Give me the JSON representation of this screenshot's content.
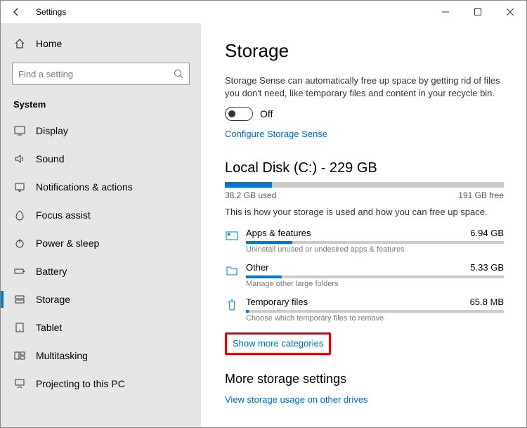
{
  "window": {
    "title": "Settings"
  },
  "sidebar": {
    "home": "Home",
    "search_placeholder": "Find a setting",
    "group": "System",
    "items": [
      {
        "label": "Display"
      },
      {
        "label": "Sound"
      },
      {
        "label": "Notifications & actions"
      },
      {
        "label": "Focus assist"
      },
      {
        "label": "Power & sleep"
      },
      {
        "label": "Battery"
      },
      {
        "label": "Storage"
      },
      {
        "label": "Tablet"
      },
      {
        "label": "Multitasking"
      },
      {
        "label": "Projecting to this PC"
      }
    ]
  },
  "page": {
    "title": "Storage",
    "sense_desc": "Storage Sense can automatically free up space by getting rid of files you don't need, like temporary files and content in your recycle bin.",
    "toggle_label": "Off",
    "configure_link": "Configure Storage Sense",
    "disk_title": "Local Disk (C:) - 229 GB",
    "used_label": "38.2 GB used",
    "free_label": "191 GB free",
    "usage_desc": "This is how your storage is used and how you can free up space.",
    "categories": [
      {
        "name": "Apps & features",
        "size": "6.94 GB",
        "hint": "Uninstall unused or undesired apps & features",
        "pct": 18
      },
      {
        "name": "Other",
        "size": "5.33 GB",
        "hint": "Manage other large folders",
        "pct": 14
      },
      {
        "name": "Temporary files",
        "size": "65.8 MB",
        "hint": "Choose which temporary files to remove",
        "pct": 1
      }
    ],
    "show_more": "Show more categories",
    "more_header": "More storage settings",
    "other_drives": "View storage usage on other drives"
  }
}
